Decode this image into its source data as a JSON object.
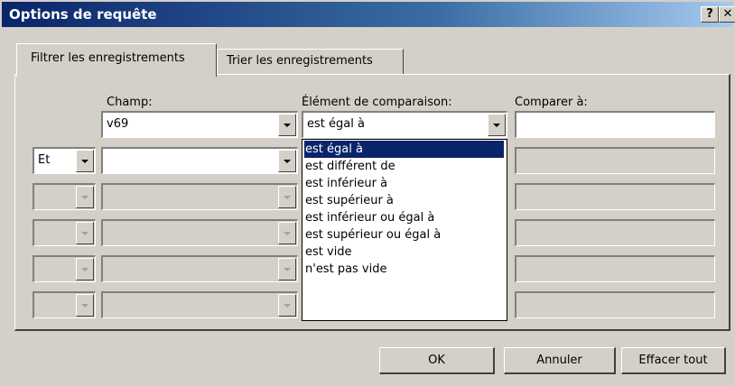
{
  "window": {
    "title": "Options de requête",
    "help_label": "?",
    "close_label": "✕"
  },
  "tabs": [
    {
      "label": "Filtrer les enregistrements",
      "active": true
    },
    {
      "label": "Trier les enregistrements",
      "active": false
    }
  ],
  "headers": {
    "field": "Champ:",
    "comparison": "Élément de comparaison:",
    "compare_to": "Comparer à:"
  },
  "rows": [
    {
      "connector": "",
      "field": "v69",
      "comparison": "est égal à",
      "compare_to": "",
      "enabled": true
    },
    {
      "connector": "Et",
      "field": "",
      "comparison": "",
      "compare_to": "",
      "enabled": true
    },
    {
      "connector": "",
      "field": "",
      "comparison": "",
      "compare_to": "",
      "enabled": false
    },
    {
      "connector": "",
      "field": "",
      "comparison": "",
      "compare_to": "",
      "enabled": false
    },
    {
      "connector": "",
      "field": "",
      "comparison": "",
      "compare_to": "",
      "enabled": false
    },
    {
      "connector": "",
      "field": "",
      "comparison": "",
      "compare_to": "",
      "enabled": false
    }
  ],
  "comparison_options": [
    "est égal à",
    "est différent de",
    "est inférieur à",
    "est supérieur à",
    "est inférieur ou égal à",
    "est supérieur ou égal à",
    "est vide",
    "n'est pas vide"
  ],
  "selected_option": "est égal à",
  "buttons": {
    "ok": "OK",
    "cancel": "Annuler",
    "clear": "Effacer tout"
  },
  "colors": {
    "face": "#d4d0c8",
    "title_start": "#0a246a",
    "title_end": "#a6caf0",
    "selection": "#0a246a"
  }
}
